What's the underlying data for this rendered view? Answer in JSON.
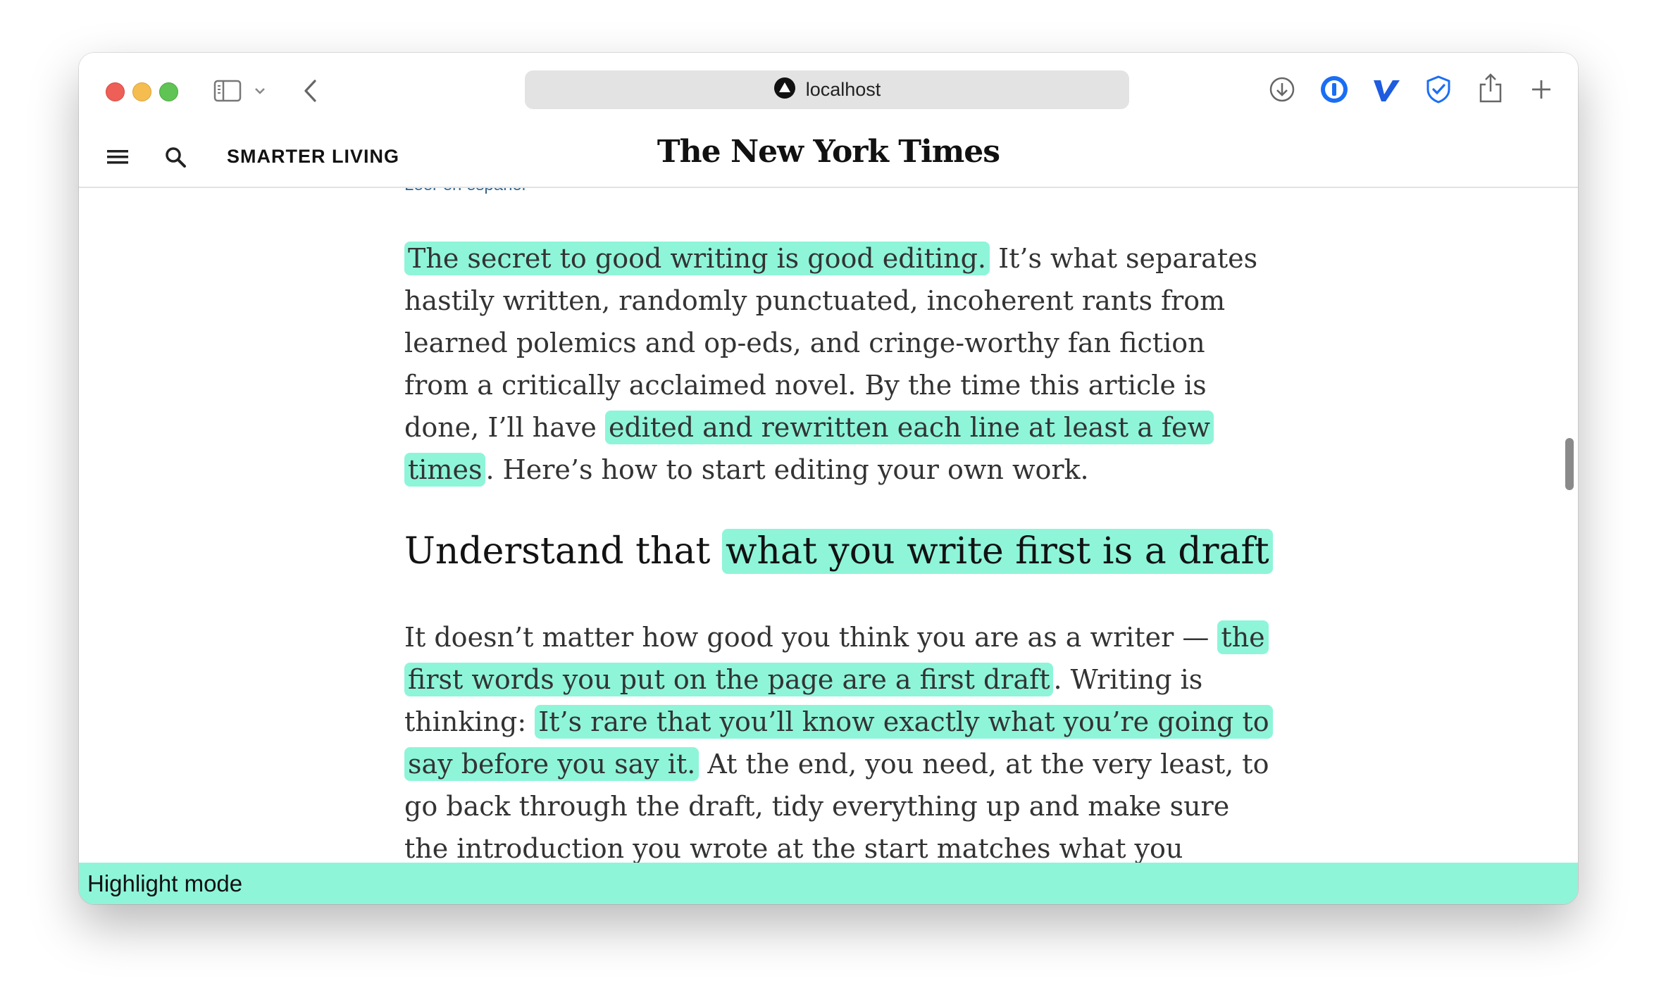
{
  "browser": {
    "url": "localhost",
    "url_icon": "site-triangle-icon",
    "toolbar_icons": [
      "sidebar-icon",
      "chevron-down-icon",
      "back-icon",
      "download-icon",
      "onepassword-icon",
      "v-extension-icon",
      "shield-check-icon",
      "share-icon",
      "plus-icon"
    ]
  },
  "site": {
    "section": "SMARTER LIVING",
    "masthead": "The New York Times"
  },
  "article": {
    "leer_link": "Leer en español",
    "p1": {
      "hl1": "The secret to good writing is good editing.",
      "t1": " It’s what separates hastily written, randomly punctuated, incoherent rants from learned polemics and op-eds, and cringe-worthy fan fiction from a critically acclaimed novel. By the time this article is done, I’ll have ",
      "hl2": "edited and rewritten each line at least a few times",
      "t2": ". Here’s how to start editing your own work."
    },
    "heading": {
      "t1": "Understand that ",
      "hl1": "what you write first is a draft"
    },
    "p2": {
      "t1": "It doesn’t matter how good you think you are as a writer — ",
      "hl1": "the first words you put on the page are a first draft",
      "t2": ". Writing is thinking: ",
      "hl2": "It’s rare that you’ll know exactly what you’re going to say before you say it.",
      "t3": " At the end, you need, at the very least, to go back through the draft, tidy everything up and make sure the introduction you wrote at the start matches what you eventually said."
    }
  },
  "status": {
    "label": "Highlight mode"
  },
  "colors": {
    "highlight": "#8ef5d9",
    "link": "#326891"
  }
}
